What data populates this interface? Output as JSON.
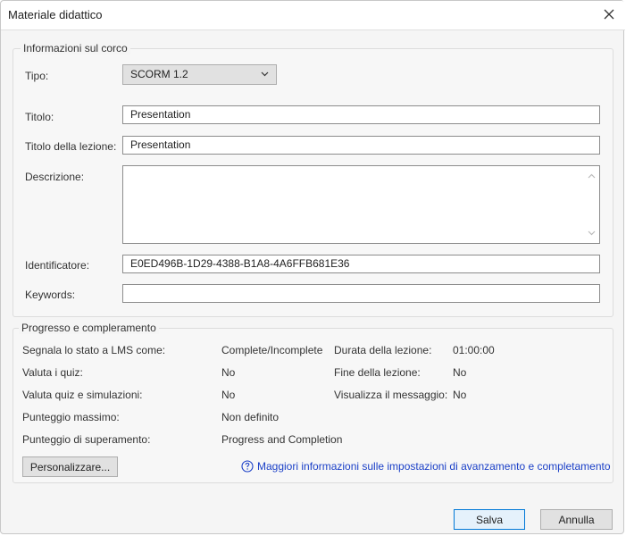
{
  "dialog": {
    "title": "Materiale didattico"
  },
  "course_info": {
    "legend": "Informazioni sul corco",
    "type_label": "Tipo:",
    "type_value": "SCORM 1.2",
    "title_label": "Titolo:",
    "title_value": "Presentation",
    "lesson_title_label": "Titolo della lezione:",
    "lesson_title_value": "Presentation",
    "description_label": "Descrizione:",
    "description_value": "",
    "identifier_label": "Identificatore:",
    "identifier_value": "E0ED496B-1D29-4388-B1A8-4A6FFB681E36",
    "keywords_label": "Keywords:",
    "keywords_value": ""
  },
  "progress": {
    "legend": "Progresso e compleramento",
    "report_label": "Segnala lo stato a LMS come:",
    "report_value": "Complete/Incomplete",
    "duration_label": "Durata della lezione:",
    "duration_value": "01:00:00",
    "eval_quiz_label": "Valuta i quiz:",
    "eval_quiz_value": "No",
    "lesson_end_label": "Fine della lezione:",
    "lesson_end_value": "No",
    "eval_sim_label": "Valuta quiz e simulazioni:",
    "eval_sim_value": "No",
    "show_msg_label": "Visualizza il messaggio:",
    "show_msg_value": "No",
    "max_score_label": "Punteggio massimo:",
    "max_score_value": "Non definito",
    "pass_score_label": "Punteggio di superamento:",
    "pass_score_value": "Progress and Completion",
    "customize_label": "Personalizzare...",
    "help_link_text": "Maggiori informazioni sulle impostazioni di avanzamento e completamento"
  },
  "footer": {
    "save_label": "Salva",
    "cancel_label": "Annulla"
  },
  "colors": {
    "link": "#1a3fc7",
    "primary_border": "#0078d7"
  },
  "icons": {
    "close": "close-icon",
    "dropdown": "chevron-down-icon",
    "help": "help-circle-icon"
  }
}
